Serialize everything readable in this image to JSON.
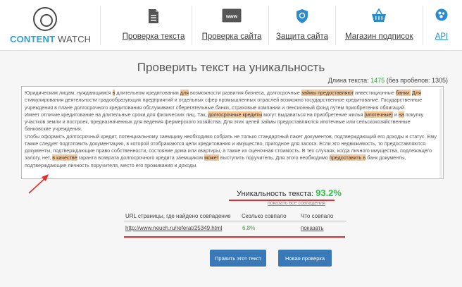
{
  "brand": {
    "name_bold": "CONTENT",
    "name_rest": " WATCH"
  },
  "nav": [
    {
      "label": "Проверка текста",
      "icon": "document-icon"
    },
    {
      "label": "Проверка сайта",
      "icon": "www-icon"
    },
    {
      "label": "Защита сайта",
      "icon": "shield-icon"
    },
    {
      "label": "Магазин подписок",
      "icon": "basket-icon"
    },
    {
      "label": "API",
      "icon": "api-icon"
    }
  ],
  "page": {
    "title": "Проверить текст на уникальность"
  },
  "length": {
    "label": "Длина текста:",
    "value": "1475",
    "no_spaces": "(без пробелов: 1305)"
  },
  "text": {
    "segments": [
      {
        "t": "Юридическим лицам, нуждающимся "
      },
      {
        "t": "в",
        "h": true
      },
      {
        "t": " длительном кредитовании "
      },
      {
        "t": "для",
        "h": true
      },
      {
        "t": " возможности развития бизнеса, долгосрочные "
      },
      {
        "t": "займы предоставляют",
        "h": true
      },
      {
        "t": " инвестиционные "
      },
      {
        "t": "банки.",
        "h": true
      },
      {
        "t": " "
      },
      {
        "t": "Для",
        "h": true
      },
      {
        "t": " стимулирования деятельности градообразующих предприятий и отдельных сфер промышленных отраслей возможно государственное кредитование. Государственные учреждения в плане долгосрочного кредитования обслуживают сберегательные банки, страховые компании и пенсионный фонд путем приобретения облигаций.\nИмеет отличие кредитование на длительные сроки для физических лиц. Так, "
      },
      {
        "t": "долгосрочные кредиты",
        "h": true
      },
      {
        "t": " могут выдаваться на приобретение жилья "
      },
      {
        "t": "(ипотечные)",
        "h": true
      },
      {
        "t": " и "
      },
      {
        "t": "на",
        "h": true
      },
      {
        "t": " покупку участков земли и построек, предназначенных для ведения фермерского хозяйства. Для этих целей займы предоставляются ипотечные или сельскохозяйственные банковские учреждения.\nЧтобы оформить долгосрочный кредит, потенциальному заемщику необходимо собрать не только стандартный пакет документов, подтверждающий его доходы и статус. Ему также следует подготовить документацию, в которой отображаются цели кредитования и имущество, пригодное для залога. Если это недвижимость, то предоставляются документы, подтверждающие право собственности, состояние дома или квартиры, а также их оценочная стоимость. В тех случаях, когда личного имущества, подлежащего залогу, нет, "
      },
      {
        "t": "в качестве",
        "h": true
      },
      {
        "t": " гаранта возврата долгосрочного кредита заемщиком "
      },
      {
        "t": "может",
        "h": true
      },
      {
        "t": " выступить поручитель. Для этого необходимо "
      },
      {
        "t": "предоставить в",
        "h": true
      },
      {
        "t": " банк документы, подтверждающие личность поручителя, место его проживания и доходы."
      }
    ]
  },
  "uniqueness": {
    "label": "Уникальность текста:",
    "value": "93.2%",
    "show_all": "показать все совпадения"
  },
  "table": {
    "headers": [
      "URL страницы, где найдено совпадение",
      "Сколько совпало",
      "Что совпало"
    ],
    "rows": [
      {
        "url": "http://www.neuch.ru/referat/25349.html",
        "match": "6.8%",
        "action": "показать"
      }
    ]
  },
  "buttons": {
    "recheck": "Править этот текст",
    "new_check": "Новая проверка"
  },
  "colors": {
    "accent": "#2aa0d8",
    "highlight": "#f5c99a",
    "ok_green": "#2ec24a",
    "button_blue": "#3a79b8",
    "annotation_red": "#e42b2b"
  }
}
